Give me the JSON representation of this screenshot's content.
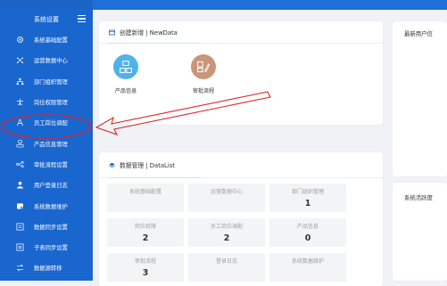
{
  "sidebar": {
    "title": "系统设置",
    "items": [
      {
        "label": "系统基础配置",
        "icon": "gear-icon"
      },
      {
        "label": "运营数据中心",
        "icon": "data-center-icon"
      },
      {
        "label": "部门组织管理",
        "icon": "org-tree-icon"
      },
      {
        "label": "岗位权限管理",
        "icon": "permission-icon"
      },
      {
        "label": "员工岗位调配",
        "icon": "user-icon"
      },
      {
        "label": "产品信息管理",
        "icon": "product-icon"
      },
      {
        "label": "审批流程设置",
        "icon": "workflow-icon"
      },
      {
        "label": "用户登录日志",
        "icon": "login-user-icon"
      },
      {
        "label": "系统数据维护",
        "icon": "database-icon"
      },
      {
        "label": "数据同步设置",
        "icon": "sync-icon"
      },
      {
        "label": "子表同步设置",
        "icon": "sub-table-icon"
      },
      {
        "label": "数据源转移",
        "icon": "transfer-icon"
      }
    ]
  },
  "newdata": {
    "title": "创建新增 | NewData",
    "items": [
      {
        "label": "产品信息",
        "color": "#4fb2e8"
      },
      {
        "label": "审批流程",
        "color": "#c8967a"
      }
    ]
  },
  "datalist": {
    "title": "数据管理 | DataList",
    "cells": [
      {
        "label": "系统基础配置",
        "value": ""
      },
      {
        "label": "运营数据中心",
        "value": ""
      },
      {
        "label": "部门组织管理",
        "value": "1"
      },
      {
        "label": "岗位权限",
        "value": "2"
      },
      {
        "label": "员工岗位调配",
        "value": "2"
      },
      {
        "label": "产品信息",
        "value": "0"
      },
      {
        "label": "审批流程",
        "value": "3"
      },
      {
        "label": "登录日志",
        "value": ""
      },
      {
        "label": "系统数据维护",
        "value": ""
      }
    ]
  },
  "right": {
    "latest_users_title": "最新用户信",
    "system_activity_title": "系统活跃度"
  },
  "colors": {
    "sidebar": "#1a66cf",
    "annotation": "#d9252a"
  }
}
